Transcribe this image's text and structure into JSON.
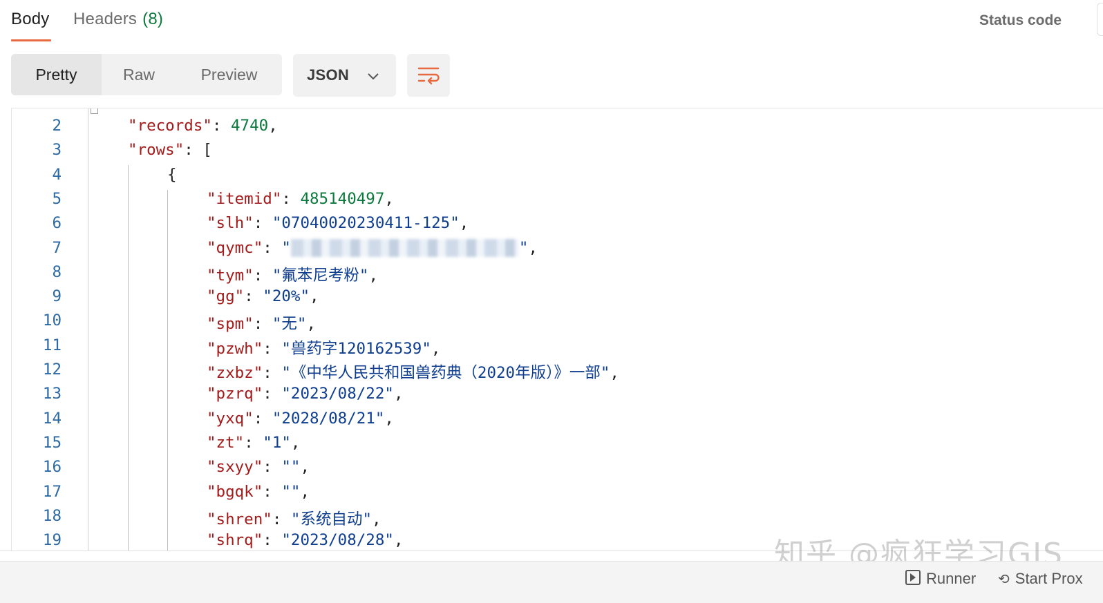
{
  "tabs": {
    "body": "Body",
    "headers": "Headers",
    "headers_count": "(8)",
    "status_code": "Status code"
  },
  "view_modes": [
    "Pretty",
    "Raw",
    "Preview"
  ],
  "format_dropdown": {
    "selected": "JSON"
  },
  "editor": {
    "lines": [
      {
        "n": "2",
        "indent": 1,
        "key": "records",
        "num": "4740",
        "tail": ","
      },
      {
        "n": "3",
        "indent": 1,
        "key": "rows",
        "raw": "["
      },
      {
        "n": "4",
        "indent": 2,
        "raw_only": "{"
      },
      {
        "n": "5",
        "indent": 3,
        "key": "itemid",
        "num": "485140497",
        "tail": ","
      },
      {
        "n": "6",
        "indent": 3,
        "key": "slh",
        "str": "07040020230411-125",
        "tail": ","
      },
      {
        "n": "7",
        "indent": 3,
        "key": "qymc",
        "redacted": true,
        "tail": ","
      },
      {
        "n": "8",
        "indent": 3,
        "key": "tym",
        "str": "氟苯尼考粉",
        "tail": ","
      },
      {
        "n": "9",
        "indent": 3,
        "key": "gg",
        "str": "20%",
        "tail": ","
      },
      {
        "n": "10",
        "indent": 3,
        "key": "spm",
        "str": "无",
        "tail": ","
      },
      {
        "n": "11",
        "indent": 3,
        "key": "pzwh",
        "str": "兽药字120162539",
        "tail": ","
      },
      {
        "n": "12",
        "indent": 3,
        "key": "zxbz",
        "str": "《中华人民共和国兽药典（2020年版）》一部",
        "tail": ","
      },
      {
        "n": "13",
        "indent": 3,
        "key": "pzrq",
        "str": "2023/08/22",
        "tail": ","
      },
      {
        "n": "14",
        "indent": 3,
        "key": "yxq",
        "str": "2028/08/21",
        "tail": ","
      },
      {
        "n": "15",
        "indent": 3,
        "key": "zt",
        "str": "1",
        "tail": ","
      },
      {
        "n": "16",
        "indent": 3,
        "key": "sxyy",
        "str": "",
        "tail": ","
      },
      {
        "n": "17",
        "indent": 3,
        "key": "bgqk",
        "str": "",
        "tail": ","
      },
      {
        "n": "18",
        "indent": 3,
        "key": "shren",
        "str": "系统自动",
        "tail": ","
      },
      {
        "n": "19",
        "indent": 3,
        "key": "shrq",
        "str": "2023/08/28",
        "tail": ","
      }
    ]
  },
  "bottom": {
    "runner": "Runner",
    "proxy": "Start Prox"
  },
  "watermark": "知乎 @疯狂学习GIS",
  "colors": {
    "accent": "#e8683f",
    "key": "#a11b1b",
    "string": "#0f3e8f",
    "number": "#0c7a3d",
    "line_number": "#2d6aa3"
  }
}
